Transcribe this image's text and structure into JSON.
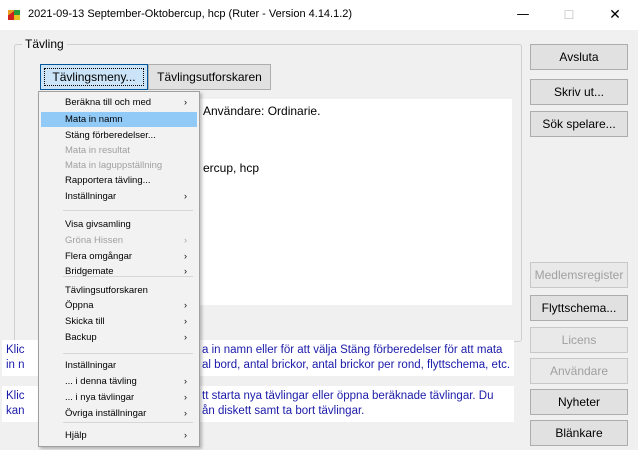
{
  "window": {
    "title": "2021-09-13 September-Oktobercup, hcp (Ruter - Version 4.14.1.2)",
    "minimize": "—",
    "maximize": "☐",
    "close": "✕"
  },
  "group": {
    "label": "Tävling"
  },
  "top_buttons": {
    "menu": "Tävlingsmeny...",
    "explorer": "Tävlingsutforskaren"
  },
  "text_area": {
    "line1": "Användare: Ordinarie.",
    "line2": "ercup, hcp"
  },
  "menu_items": [
    {
      "label": "Beräkna till och med",
      "arrow": true,
      "disabled": false,
      "selected": false
    },
    {
      "label": "Mata in namn",
      "arrow": false,
      "disabled": false,
      "selected": true
    },
    {
      "label": "Stäng förberedelser...",
      "arrow": false,
      "disabled": false,
      "selected": false
    },
    {
      "label": "Mata in resultat",
      "arrow": false,
      "disabled": true,
      "selected": false
    },
    {
      "label": "Mata in laguppställning",
      "arrow": false,
      "disabled": true,
      "selected": false
    },
    {
      "label": "Rapportera tävling...",
      "arrow": false,
      "disabled": false,
      "selected": false
    },
    {
      "label": "Inställningar",
      "arrow": true,
      "disabled": false,
      "selected": false
    },
    {
      "label": "Visa givsamling",
      "arrow": false,
      "disabled": false,
      "selected": false
    },
    {
      "label": "Gröna Hissen",
      "arrow": true,
      "disabled": true,
      "selected": false
    },
    {
      "label": "Flera omgångar",
      "arrow": true,
      "disabled": false,
      "selected": false
    },
    {
      "label": "Bridgemate",
      "arrow": true,
      "disabled": false,
      "selected": false
    },
    {
      "label": "Tävlingsutforskaren",
      "arrow": false,
      "disabled": false,
      "selected": false
    },
    {
      "label": "Öppna",
      "arrow": true,
      "disabled": false,
      "selected": false
    },
    {
      "label": "Skicka till",
      "arrow": true,
      "disabled": false,
      "selected": false
    },
    {
      "label": "Backup",
      "arrow": true,
      "disabled": false,
      "selected": false
    },
    {
      "label": "Inställningar",
      "arrow": false,
      "disabled": false,
      "selected": false
    },
    {
      "label": "... i denna tävling",
      "arrow": true,
      "disabled": false,
      "selected": false
    },
    {
      "label": "... i nya tävlingar",
      "arrow": true,
      "disabled": false,
      "selected": false
    },
    {
      "label": "Övriga inställningar",
      "arrow": true,
      "disabled": false,
      "selected": false
    },
    {
      "label": "Hjälp",
      "arrow": true,
      "disabled": false,
      "selected": false
    }
  ],
  "arrow_glyph": "›",
  "help": {
    "p1_left1": "Klic",
    "p1_left2": "in n",
    "p1_right1": "a in namn eller för att välja Stäng förberedelser för att mata",
    "p1_right2": "al bord, antal brickor, antal brickor per rond, flyttschema, etc.",
    "p2_left1": "Klic",
    "p2_left2": "kan",
    "p2_right1": "tt starta nya tävlingar eller öppna beräknade tävlingar. Du",
    "p2_right2": "ån diskett samt ta bort tävlingar."
  },
  "side_buttons": {
    "quit": "Avsluta",
    "print": "Skriv ut...",
    "search": "Sök spelare...",
    "registry": "Medlemsregister",
    "movement": "Flyttschema...",
    "license": "Licens",
    "users": "Användare",
    "news": "Nyheter",
    "blanks": "Blänkare"
  },
  "colors": {
    "help_text": "#1a1aaa",
    "menu_highlight": "#91c9f7",
    "disabled_text": "#a0a0a0"
  }
}
